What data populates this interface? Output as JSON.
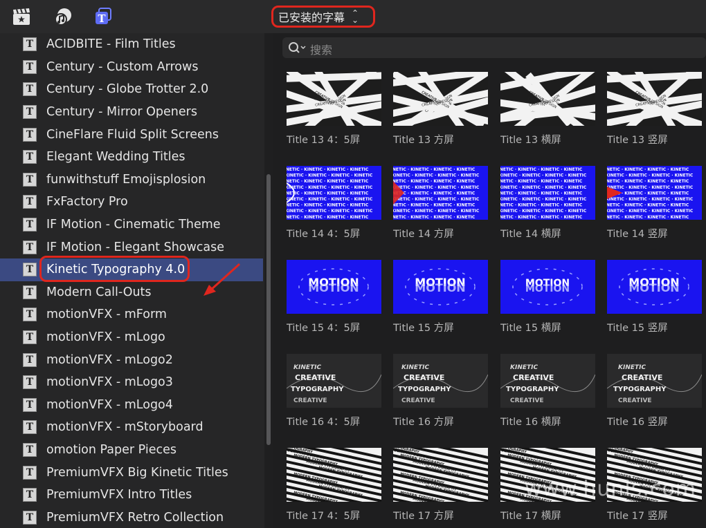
{
  "toolbar": {
    "icons": [
      "clapper-icon",
      "music-photo-icon",
      "titles-icon"
    ],
    "dropdown_label": "已安装的字幕",
    "dropdown_chevron": "⌃⌄"
  },
  "sidebar": {
    "selected_index": 10,
    "items": [
      {
        "label": "ACIDBITE - Film Titles"
      },
      {
        "label": "Century - Custom Arrows"
      },
      {
        "label": "Century - Globe Trotter 2.0"
      },
      {
        "label": "Century - Mirror Openers"
      },
      {
        "label": "CineFlare Fluid Split Screens"
      },
      {
        "label": "Elegant Wedding Titles"
      },
      {
        "label": "funwithstuff Emojisplosion"
      },
      {
        "label": "FxFactory Pro"
      },
      {
        "label": "IF Motion - Cinematic Theme"
      },
      {
        "label": "IF Motion - Elegant Showcase"
      },
      {
        "label": "Kinetic Typography 4.0"
      },
      {
        "label": "Modern Call-Outs"
      },
      {
        "label": "motionVFX - mForm"
      },
      {
        "label": "motionVFX - mLogo"
      },
      {
        "label": "motionVFX - mLogo2"
      },
      {
        "label": "motionVFX - mLogo3"
      },
      {
        "label": "motionVFX - mLogo4"
      },
      {
        "label": "motionVFX - mStoryboard"
      },
      {
        "label": "omotion Paper Pieces"
      },
      {
        "label": "PremiumVFX Big Kinetic Titles"
      },
      {
        "label": "PremiumVFX Intro Titles"
      },
      {
        "label": "PremiumVFX Retro Collection"
      }
    ]
  },
  "search": {
    "placeholder": "搜索"
  },
  "grid": {
    "rows": [
      {
        "style": "tape-cross",
        "captions": [
          "Title 13 4：5屏",
          "Title 13 方屏",
          "Title 13 横屏",
          "Title 13 竖屏"
        ]
      },
      {
        "style": "kinetic-blue",
        "captions": [
          "Title 14 4：5屏",
          "Title 14 方屏",
          "Title 14 横屏",
          "Title 14 竖屏"
        ]
      },
      {
        "style": "motion-blue",
        "captions": [
          "Title 15 4：5屏",
          "Title 15 方屏",
          "Title 15 横屏",
          "Title 15 竖屏"
        ]
      },
      {
        "style": "creative-dark",
        "captions": [
          "Title 16 4：5屏",
          "Title 16 方屏",
          "Title 16 横屏",
          "Title 16 竖屏"
        ]
      },
      {
        "style": "modern-stripes",
        "captions": [
          "Title 17 4：5屏",
          "Title 17 方屏",
          "Title 17 横屏",
          "Title 17 竖屏"
        ]
      }
    ],
    "thumb_text": {
      "tape": "CREATIVE DESIGN",
      "kinetic": "KINETIC · KINETIC · KINETIC · KINETIC",
      "motion": "MOTION",
      "kinetic_small": "KINETIC",
      "creative": "CREATIVE",
      "typography": "TYPOGRAPHY",
      "modern": "MODERN TYPOGRAPHY"
    }
  },
  "watermark": "www.hunls.com",
  "colors": {
    "accent_red": "#e0261e",
    "selection": "#3b4a82",
    "thumb_blue": "#1a14f0"
  }
}
